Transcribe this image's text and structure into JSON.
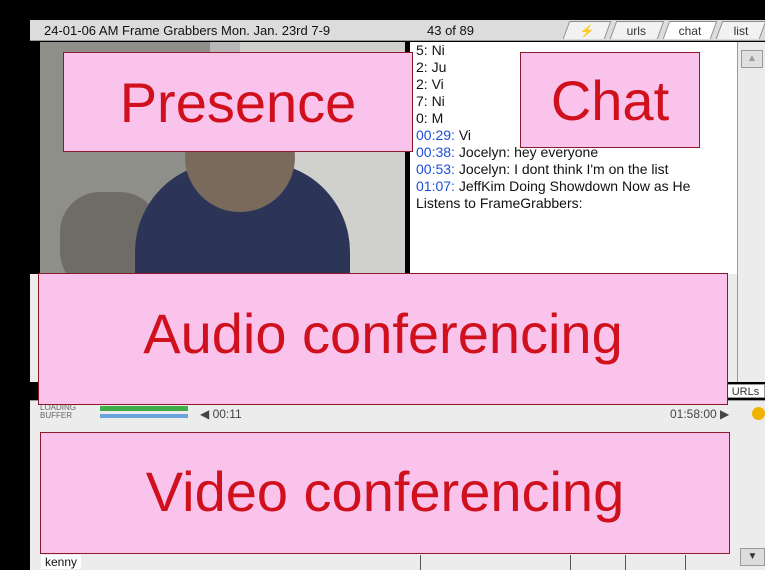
{
  "header": {
    "event_title": "24-01-06 AM Frame Grabbers Mon. Jan. 23rd 7-9",
    "message_counter": "43 of 89"
  },
  "tabs": [
    {
      "label": "⚡"
    },
    {
      "label": "urls"
    },
    {
      "label": "chat"
    },
    {
      "label": "list"
    }
  ],
  "chat": {
    "lines": [
      {
        "time": "",
        "text": "5: Ni"
      },
      {
        "time": "",
        "text": "2: Ju"
      },
      {
        "time": "",
        "text": "2: Vi"
      },
      {
        "time": "",
        "text": "7: Ni"
      },
      {
        "time": "",
        "text": "0: M"
      },
      {
        "time": "00:29:",
        "text": " Vi                          excited, Eric"
      },
      {
        "time": "00:38:",
        "text": " Jocelyn: hey everyone"
      },
      {
        "time": "00:53:",
        "text": " Jocelyn: I dont think I'm on the list"
      },
      {
        "time": "01:07:",
        "text": " JeffKim Doing Showdown Now as He Listens to FrameGrabbers:"
      }
    ]
  },
  "urls_tab": "URLs",
  "timeline": {
    "buffer_label_1": "LOADING",
    "buffer_label_2": "BUFFER",
    "current_time": "◀ 00:11",
    "end_time": "01:58:00 ▶"
  },
  "participants": {
    "first_name": "kenny"
  },
  "callouts": {
    "presence": "Presence",
    "chat": "Chat",
    "audio": "Audio conferencing",
    "video": "Video conferencing"
  },
  "colors": {
    "callout_fill": "#f9c3ec",
    "callout_text": "#d0101c",
    "timestamp": "#1d4fd6"
  }
}
